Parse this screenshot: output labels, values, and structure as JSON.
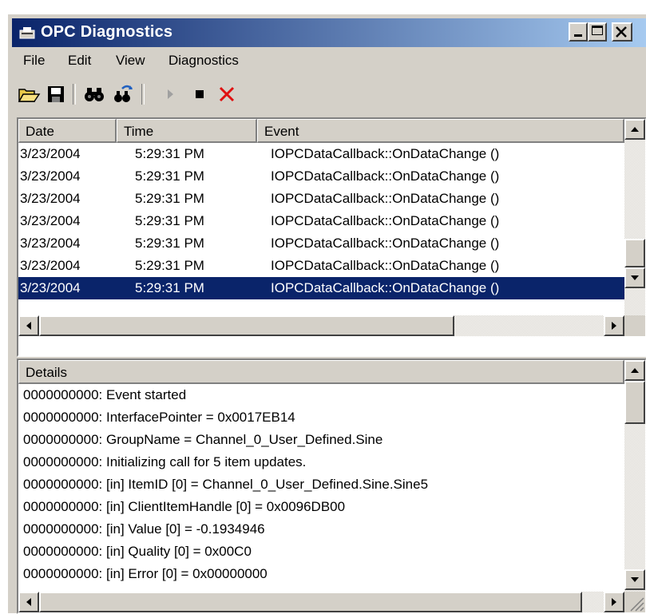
{
  "window": {
    "title": "OPC Diagnostics"
  },
  "menu": [
    "File",
    "Edit",
    "View",
    "Diagnostics"
  ],
  "toolbar": {
    "icons": [
      "open-folder-icon",
      "save-disk-icon",
      "binoculars-icon",
      "find-next-icon",
      "play-icon",
      "stop-icon",
      "clear-x-icon"
    ]
  },
  "events": {
    "columns": [
      "Date",
      "Time",
      "Event"
    ],
    "rows": [
      {
        "date": "3/23/2004",
        "time": "5:29:31 PM",
        "event": "IOPCDataCallback::OnDataChange ()"
      },
      {
        "date": "3/23/2004",
        "time": "5:29:31 PM",
        "event": "IOPCDataCallback::OnDataChange ()"
      },
      {
        "date": "3/23/2004",
        "time": "5:29:31 PM",
        "event": "IOPCDataCallback::OnDataChange ()"
      },
      {
        "date": "3/23/2004",
        "time": "5:29:31 PM",
        "event": "IOPCDataCallback::OnDataChange ()"
      },
      {
        "date": "3/23/2004",
        "time": "5:29:31 PM",
        "event": "IOPCDataCallback::OnDataChange ()"
      },
      {
        "date": "3/23/2004",
        "time": "5:29:31 PM",
        "event": "IOPCDataCallback::OnDataChange ()"
      },
      {
        "date": "3/23/2004",
        "time": "5:29:31 PM",
        "event": "IOPCDataCallback::OnDataChange ()"
      }
    ],
    "selected_index": 6
  },
  "details": {
    "header": "Details",
    "lines": [
      "0000000000: Event started",
      "0000000000: InterfacePointer = 0x0017EB14",
      "0000000000: GroupName = Channel_0_User_Defined.Sine",
      "0000000000: Initializing call for 5 item updates.",
      "0000000000: [in] ItemID [0] = Channel_0_User_Defined.Sine.Sine5",
      "0000000000: [in] ClientItemHandle [0] = 0x0096DB00",
      "0000000000: [in] Value [0] = -0.1934946",
      "0000000000: [in] Quality [0] = 0x00C0",
      "0000000000: [in] Error [0] = 0x00000000"
    ]
  },
  "colors": {
    "titlebar_start": "#0a246a",
    "titlebar_end": "#a6caf0",
    "selection": "#0a246a",
    "face": "#d4d0c8"
  }
}
